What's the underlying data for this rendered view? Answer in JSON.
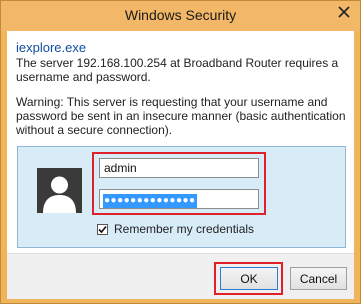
{
  "window": {
    "title": "Windows Security"
  },
  "dialog": {
    "app_name": "iexplore.exe",
    "message": "The server 192.168.100.254 at Broadband Router requires a username and password.",
    "warning": "Warning: This server is requesting that your username and password be sent in an insecure manner (basic authentication without a secure connection)."
  },
  "credentials": {
    "username_value": "admin",
    "password_mask": "●●●●●●●●●●●●●●",
    "remember_label": "Remember my credentials",
    "remember_checked": true
  },
  "buttons": {
    "ok_label": "OK",
    "cancel_label": "Cancel"
  },
  "colors": {
    "title_bar": "#f2b767",
    "highlight_border": "#e0212c",
    "panel_bg": "#d8ecf8",
    "app_name_text": "#0f4ea0",
    "selection": "#3399ff"
  },
  "icons": {
    "close": "close-icon",
    "user": "user-avatar-icon",
    "check": "checkmark-icon"
  }
}
